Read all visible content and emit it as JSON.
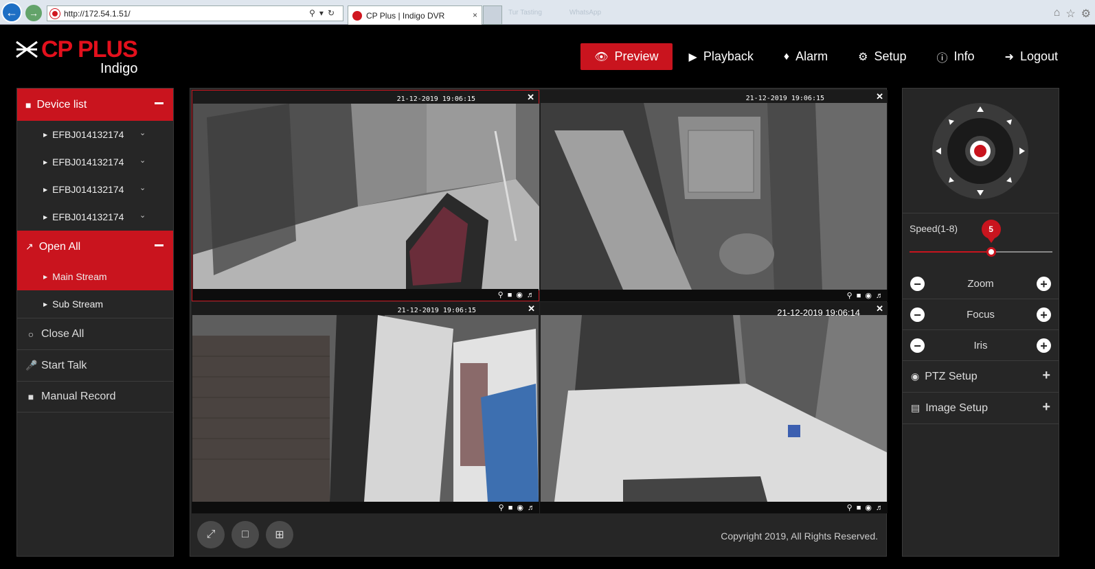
{
  "browser": {
    "url": "http://172.54.1.51/",
    "tab_title": "CP Plus | Indigo DVR",
    "tab_close": "×",
    "blurred_tabs": [
      "Tur Tasting",
      "WhatsApp"
    ]
  },
  "brand": {
    "name": "CP PLUS",
    "product": "Indigo",
    "accent": "#c9141e"
  },
  "nav": [
    {
      "label": "Preview",
      "icon": "eye-icon",
      "active": true
    },
    {
      "label": "Playback",
      "icon": "play-circle-icon",
      "active": false
    },
    {
      "label": "Alarm",
      "icon": "bell-icon",
      "active": false
    },
    {
      "label": "Setup",
      "icon": "gear-icon",
      "active": false
    },
    {
      "label": "Info",
      "icon": "info-icon",
      "active": false
    },
    {
      "label": "Logout",
      "icon": "logout-icon",
      "active": false
    }
  ],
  "sidebar": {
    "device_list_label": "Device list",
    "devices": [
      "EFBJ014132174",
      "EFBJ014132174",
      "EFBJ014132174",
      "EFBJ014132174"
    ],
    "open_all_label": "Open All",
    "streams": [
      {
        "label": "Main Stream",
        "active": true
      },
      {
        "label": "Sub Stream",
        "active": false
      }
    ],
    "actions": [
      {
        "label": "Close All",
        "icon": "circle-icon"
      },
      {
        "label": "Start Talk",
        "icon": "microphone-icon"
      },
      {
        "label": "Manual Record",
        "icon": "video-camera-icon"
      }
    ]
  },
  "cameras": [
    {
      "timestamp": "21-12-2019 19:06:15"
    },
    {
      "timestamp": "21-12-2019 19:06:15"
    },
    {
      "timestamp": "21-12-2019 19:06:15"
    },
    {
      "timestamp": "21-12-2019 19:06:14"
    }
  ],
  "footer": {
    "copyright": "Copyright 2019, All Rights Reserved."
  },
  "ptz": {
    "speed_label": "Speed(1-8)",
    "speed_value": "5",
    "speed_fraction": 0.57,
    "controls": [
      "Zoom",
      "Focus",
      "Iris"
    ],
    "sections": [
      {
        "label": "PTZ Setup",
        "icon": "gamepad-icon"
      },
      {
        "label": "Image Setup",
        "icon": "image-file-icon"
      }
    ]
  }
}
